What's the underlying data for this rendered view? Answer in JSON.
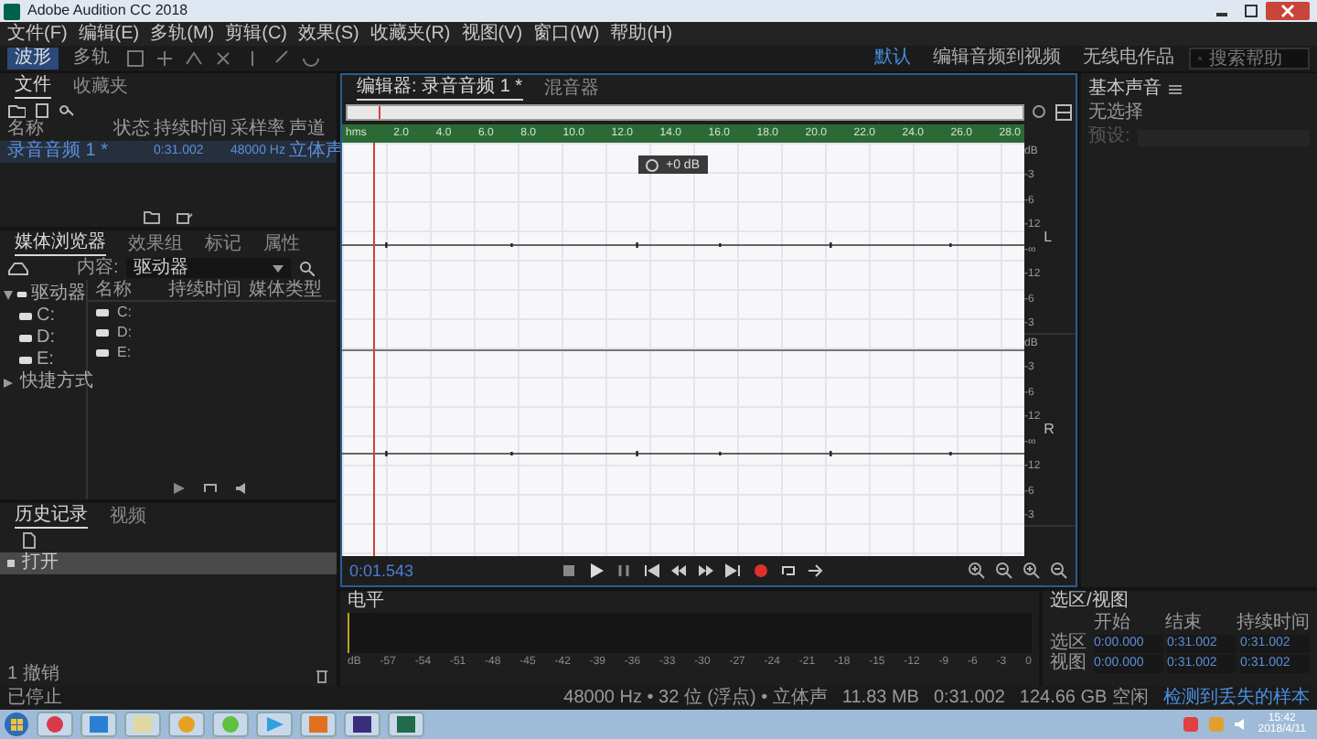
{
  "window": {
    "title": "Adobe Audition CC 2018"
  },
  "menu": [
    "文件(F)",
    "编辑(E)",
    "多轨(M)",
    "剪辑(C)",
    "效果(S)",
    "收藏夹(R)",
    "视图(V)",
    "窗口(W)",
    "帮助(H)"
  ],
  "modes": [
    {
      "label": "波形",
      "selected": true
    },
    {
      "label": "多轨",
      "selected": false
    }
  ],
  "workspaces": [
    {
      "label": "默认",
      "selected": true
    },
    {
      "label": "编辑音频到视频",
      "selected": false
    },
    {
      "label": "无线电作品",
      "selected": false
    }
  ],
  "search": {
    "placeholder": "搜索帮助"
  },
  "files_panel": {
    "tabs": [
      {
        "label": "文件",
        "selected": true
      },
      {
        "label": "收藏夹",
        "selected": false
      }
    ],
    "columns": [
      "名称",
      "状态",
      "持续时间",
      "采样率",
      "声道"
    ],
    "rows": [
      {
        "name": "录音音频 1 *",
        "duration": "0:31.002",
        "sample_rate": "48000 Hz",
        "channels": "立体声",
        "selected": true
      }
    ]
  },
  "media_browser": {
    "tabs": [
      {
        "label": "媒体浏览器",
        "selected": true
      },
      {
        "label": "效果组",
        "selected": false
      },
      {
        "label": "标记",
        "selected": false
      },
      {
        "label": "属性",
        "selected": false
      }
    ],
    "content_label": "内容:",
    "content_value": "驱动器",
    "tree": [
      {
        "label": "驱动器",
        "expanded": true,
        "children": [
          {
            "label": "C:"
          },
          {
            "label": "D:"
          },
          {
            "label": "E:"
          }
        ]
      },
      {
        "label": "快捷方式",
        "expanded": false
      }
    ],
    "columns": [
      "名称",
      "持续时间",
      "媒体类型"
    ],
    "rows": [
      "C:",
      "D:",
      "E:"
    ]
  },
  "history": {
    "tabs": [
      {
        "label": "历史记录",
        "selected": true
      },
      {
        "label": "视频",
        "selected": false
      }
    ],
    "items": [
      {
        "label": "打开",
        "selected": true
      }
    ],
    "footer": "1 撤销"
  },
  "editor": {
    "tabs": [
      {
        "label": "编辑器: 录音音频 1 *",
        "selected": true
      },
      {
        "label": "混音器",
        "selected": false
      }
    ],
    "ruler": [
      "hms",
      "2.0",
      "4.0",
      "6.0",
      "8.0",
      "10.0",
      "12.0",
      "14.0",
      "16.0",
      "18.0",
      "20.0",
      "22.0",
      "24.0",
      "26.0",
      "28.0"
    ],
    "hud": "+0 dB",
    "channels": [
      {
        "label": "L",
        "scale": [
          "dB",
          "-3",
          "-6",
          "-12",
          "-∞",
          "-12",
          "-6",
          "-3"
        ]
      },
      {
        "label": "R",
        "scale": [
          "dB",
          "-3",
          "-6",
          "-12",
          "-∞",
          "-12",
          "-6",
          "-3"
        ]
      }
    ],
    "time": "0:01.543"
  },
  "levels": {
    "title": "电平",
    "scale": [
      "dB",
      "-57",
      "-54",
      "-51",
      "-48",
      "-45",
      "-42",
      "-39",
      "-36",
      "-33",
      "-30",
      "-27",
      "-24",
      "-21",
      "-18",
      "-15",
      "-12",
      "-9",
      "-6",
      "-3",
      "0"
    ]
  },
  "selection_view": {
    "title": "选区/视图",
    "columns": [
      "开始",
      "结束",
      "持续时间"
    ],
    "rows": [
      {
        "label": "选区",
        "values": [
          "0:00.000",
          "0:31.002",
          "0:31.002"
        ]
      },
      {
        "label": "视图",
        "values": [
          "0:00.000",
          "0:31.002",
          "0:31.002"
        ]
      }
    ]
  },
  "essential_sound": {
    "title": "基本声音",
    "message": "无选择",
    "preset_label": "预设:"
  },
  "status_bar": {
    "state": "已停止",
    "items": [
      "48000 Hz • 32 位 (浮点) • 立体声",
      "11.83 MB",
      "0:31.002",
      "124.66 GB 空闲"
    ],
    "warning": "检测到丢失的样本"
  },
  "taskbar": {
    "time": "15:42",
    "date": "2018/4/11"
  }
}
